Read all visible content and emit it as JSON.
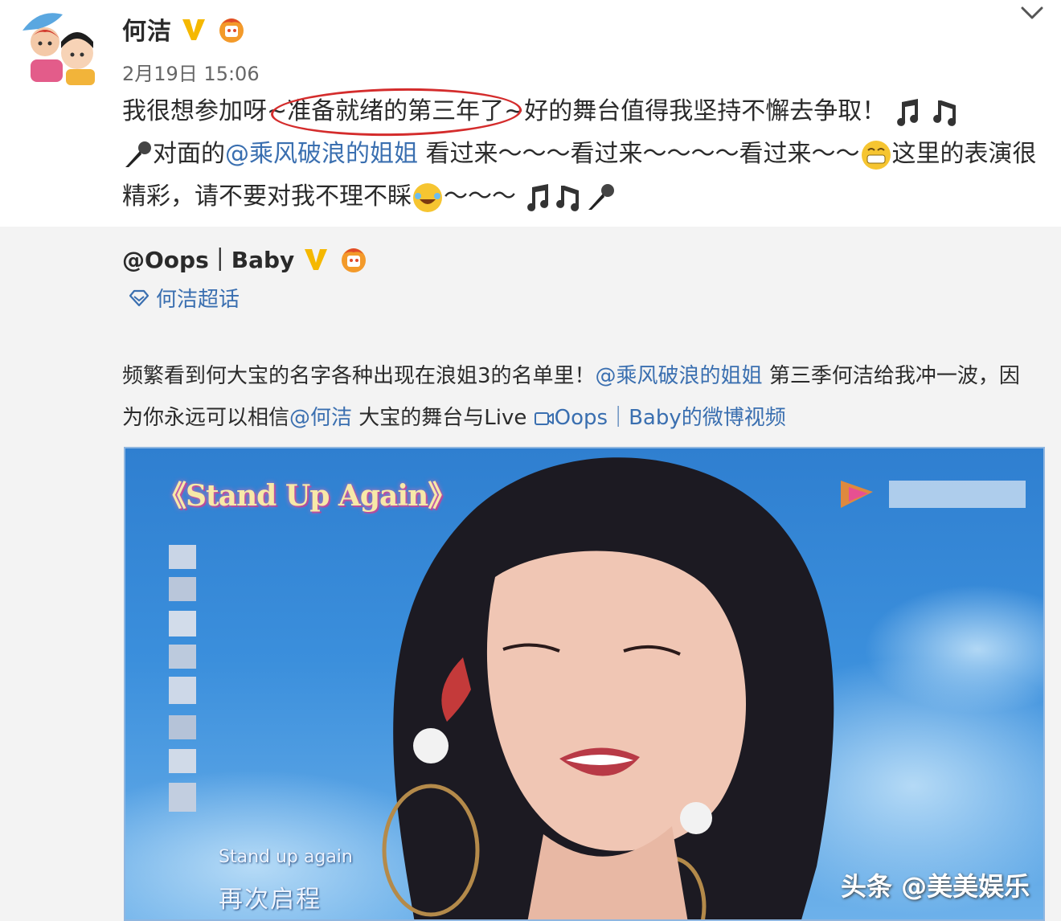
{
  "post": {
    "author": "何洁",
    "timestamp": "2月19日 15:06",
    "text": {
      "p1": "我很想参加呀~",
      "highlight": "准备就绪的第三年了",
      "p2": "~好的舞台值得我坚持不懈去争取！",
      "p3": "对面的",
      "mention": "@乘风破浪的姐姐",
      "p4": " 看过来～～～看过来～～～～看过来～～",
      "p5": "这里的表演很精彩，请不要对我不理不睬",
      "p6": "～～～"
    }
  },
  "repost": {
    "author": "@Oops｜Baby",
    "topic": "何洁超话",
    "text": {
      "t1": "频繁看到何大宝的名字各种出现在浪姐3的名单里！",
      "mention1": "@乘风破浪的姐姐",
      "t2": " 第三季何洁给我冲一波，因为你永远可以相信",
      "mention2": "@何洁",
      "t3": " 大宝的舞台与Live ",
      "video_link": "Oops｜Baby的微博视频"
    }
  },
  "video": {
    "title": "《Stand Up Again》",
    "caption_en": "Stand up again",
    "caption_zh": "再次启程"
  },
  "watermark": "头条 @美美娱乐",
  "colors": {
    "link": "#3a6fb0",
    "highlight_circle": "#d42c2c",
    "repost_bg": "#f3f3f3",
    "verified": "#f5b800"
  }
}
